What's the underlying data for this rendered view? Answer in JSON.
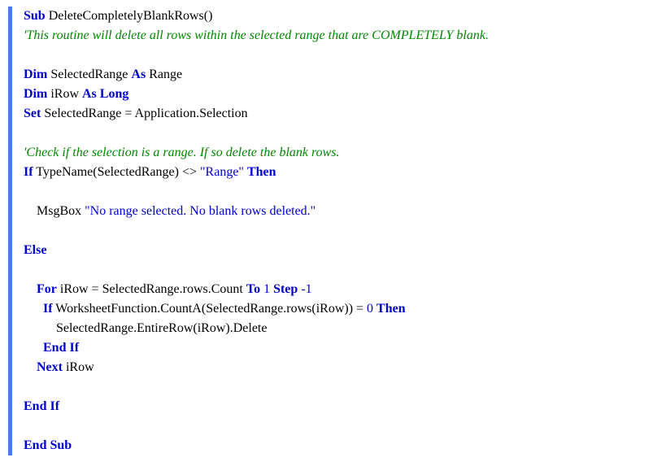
{
  "code": {
    "l1_kw1": "Sub",
    "l1_name": " DeleteCompletelyBlankRows()",
    "l2_comment": "'This routine will delete all rows within the selected range that are COMPLETELY blank.",
    "l4_kw1": "Dim",
    "l4_id": " SelectedRange ",
    "l4_kw2": "As",
    "l4_type": " Range",
    "l5_kw1": "Dim",
    "l5_id": " iRow ",
    "l5_kw2": "As Long",
    "l6_kw1": "Set",
    "l6_rest": " SelectedRange = Application.Selection",
    "l8_comment": "'Check if the selection is a range. If so delete the blank rows.",
    "l9_kw1": "If",
    "l9_mid1": " TypeName(SelectedRange) <> ",
    "l9_str": "\"Range\"",
    "l9_sp": " ",
    "l9_kw2": "Then",
    "l11_pre": "    MsgBox ",
    "l11_str": "\"No range selected. No blank rows deleted.\"",
    "l13_kw": "Else",
    "l15_pre": "    ",
    "l15_kw1": "For",
    "l15_mid": " iRow = SelectedRange.rows.Count ",
    "l15_kw2": "To",
    "l15_sp1": " ",
    "l15_num1": "1",
    "l15_sp2": " ",
    "l15_kw3": "Step",
    "l15_sp3": " ",
    "l15_num2": "-1",
    "l16_pre": "      ",
    "l16_kw1": "If",
    "l16_mid": " WorksheetFunction.CountA(SelectedRange.rows(iRow)) = ",
    "l16_num": "0",
    "l16_sp": " ",
    "l16_kw2": "Then",
    "l17_text": "          SelectedRange.EntireRow(iRow).Delete",
    "l18_pre": "      ",
    "l18_kw": "End If",
    "l19_pre": "    ",
    "l19_kw": "Next",
    "l19_id": " iRow",
    "l21_kw": "End If",
    "l23_kw": "End Sub"
  }
}
